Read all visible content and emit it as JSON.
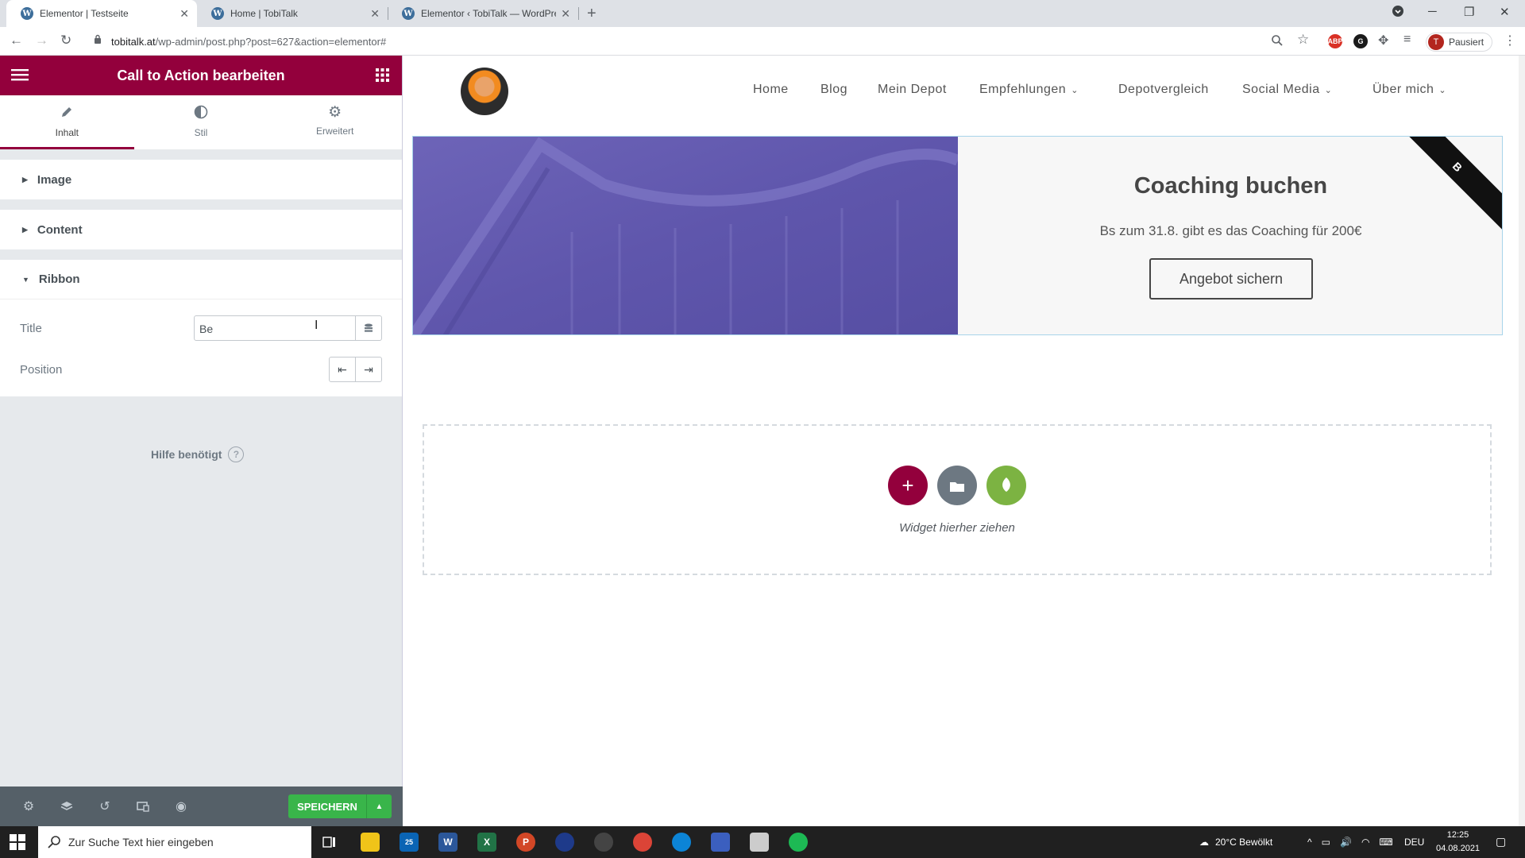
{
  "browser": {
    "tabs": [
      {
        "label": "Elementor | Testseite",
        "active": true
      },
      {
        "label": "Home | TobiTalk",
        "active": false
      },
      {
        "label": "Elementor ‹ TobiTalk — WordPre",
        "active": false
      }
    ],
    "url_host": "tobitalk.at",
    "url_path": "/wp-admin/post.php?post=627&action=elementor#",
    "profile_initial": "T",
    "profile_label": "Pausiert",
    "ext_abp": "ABP"
  },
  "panel": {
    "header_title": "Call to Action bearbeiten",
    "tabs": [
      {
        "label": "Inhalt",
        "icon": "pencil-icon"
      },
      {
        "label": "Stil",
        "icon": "contrast-icon"
      },
      {
        "label": "Erweitert",
        "icon": "gear-icon"
      }
    ],
    "sections": [
      "Image",
      "Content",
      "Ribbon"
    ],
    "ribbon_title_label": "Title",
    "ribbon_title_value": "Be",
    "ribbon_position_label": "Position",
    "help_text": "Hilfe benötigt",
    "help_icon": "?",
    "save_label": "SPEICHERN"
  },
  "site": {
    "nav": [
      {
        "label": "Home",
        "dropdown": false
      },
      {
        "label": "Blog",
        "dropdown": false
      },
      {
        "label": "Mein Depot",
        "dropdown": false
      },
      {
        "label": "Empfehlungen",
        "dropdown": true
      },
      {
        "label": "Depotvergleich",
        "dropdown": false
      },
      {
        "label": "Social Media",
        "dropdown": true
      },
      {
        "label": "Über mich",
        "dropdown": true
      }
    ],
    "cta_title": "Coaching buchen",
    "cta_description": "Bs zum 31.8. gibt es das Coaching für 200€",
    "cta_button": "Angebot sichern",
    "ribbon_text": "B",
    "drop_hint": "Widget hierher ziehen"
  },
  "taskbar": {
    "search_placeholder": "Zur Suche Text hier eingeben",
    "weather": "20°C  Bewölkt",
    "language": "DEU",
    "time": "12:25",
    "date": "04.08.2021",
    "mail_badge": "25"
  },
  "colors": {
    "elementor_accent": "#93003c",
    "save_green": "#39b54a",
    "cta_overlay": "#6d64b8"
  }
}
